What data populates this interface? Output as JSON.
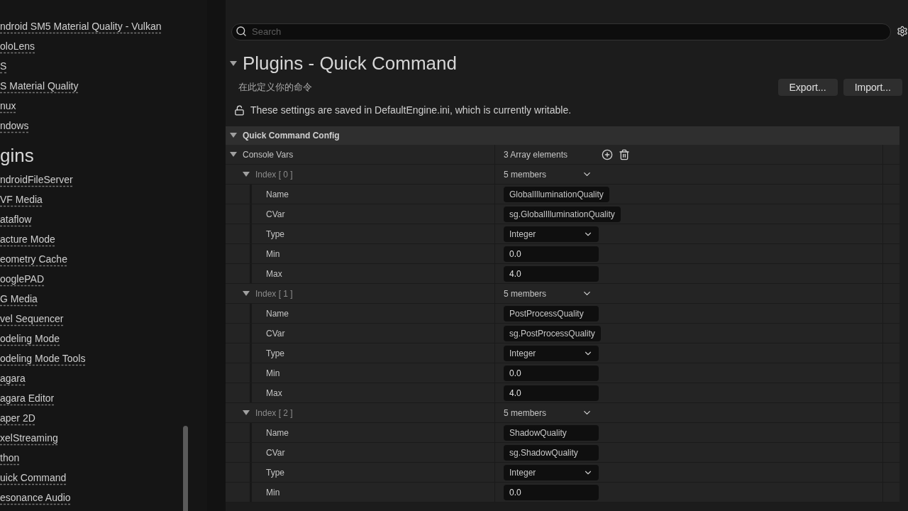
{
  "sidebar": {
    "items_top": [
      {
        "label": "ndroid SM5 Material Quality - Vulkan"
      },
      {
        "label": "oloLens"
      },
      {
        "label": "S"
      },
      {
        "label": "S Material Quality"
      },
      {
        "label": "nux"
      },
      {
        "label": "ndows"
      }
    ],
    "heading": "gins",
    "items": [
      {
        "label": "ndroidFileServer"
      },
      {
        "label": "VF Media"
      },
      {
        "label": "ataflow"
      },
      {
        "label": "acture Mode"
      },
      {
        "label": "eometry Cache"
      },
      {
        "label": "ooglePAD"
      },
      {
        "label": "G Media"
      },
      {
        "label": "vel Sequencer"
      },
      {
        "label": "odeling Mode"
      },
      {
        "label": "odeling Mode Tools"
      },
      {
        "label": "agara"
      },
      {
        "label": "agara Editor"
      },
      {
        "label": "aper 2D"
      },
      {
        "label": "xelStreaming"
      },
      {
        "label": "thon"
      },
      {
        "label": "uick Command"
      },
      {
        "label": "esonance Audio"
      }
    ]
  },
  "search": {
    "placeholder": "Search"
  },
  "page": {
    "title": "Plugins - Quick Command",
    "expanded": true,
    "subtitle": "在此定义你的命令",
    "buttons": [
      "Export...",
      "Import..."
    ],
    "notice": "These settings are saved in DefaultEngine.ini, which is currently writable.",
    "locked": false
  },
  "section": {
    "title": "Quick Command Config",
    "expanded": true,
    "array": {
      "label": "Console Vars",
      "count": "3 Array elements",
      "expanded": true,
      "elements": [
        {
          "label": "Index [ 0 ]",
          "count": "5 members",
          "expanded": true,
          "fields": [
            {
              "label": "Name",
              "kind": "text",
              "value": "GlobalIlluminationQuality"
            },
            {
              "label": "CVar",
              "kind": "text",
              "value": "sg.GlobalIlluminationQuality"
            },
            {
              "label": "Type",
              "kind": "dropdown",
              "value": "Integer"
            },
            {
              "label": "Min",
              "kind": "number",
              "value": "0.0"
            },
            {
              "label": "Max",
              "kind": "number",
              "value": "4.0"
            }
          ]
        },
        {
          "label": "Index [ 1 ]",
          "count": "5 members",
          "expanded": true,
          "fields": [
            {
              "label": "Name",
              "kind": "text",
              "value": "PostProcessQuality"
            },
            {
              "label": "CVar",
              "kind": "text",
              "value": "sg.PostProcessQuality"
            },
            {
              "label": "Type",
              "kind": "dropdown",
              "value": "Integer"
            },
            {
              "label": "Min",
              "kind": "number",
              "value": "0.0"
            },
            {
              "label": "Max",
              "kind": "number",
              "value": "4.0"
            }
          ]
        },
        {
          "label": "Index [ 2 ]",
          "count": "5 members",
          "expanded": true,
          "fields": [
            {
              "label": "Name",
              "kind": "text",
              "value": "ShadowQuality"
            },
            {
              "label": "CVar",
              "kind": "text",
              "value": "sg.ShadowQuality"
            },
            {
              "label": "Type",
              "kind": "dropdown",
              "value": "Integer"
            },
            {
              "label": "Min",
              "kind": "number",
              "value": "0.0"
            }
          ]
        }
      ]
    }
  }
}
